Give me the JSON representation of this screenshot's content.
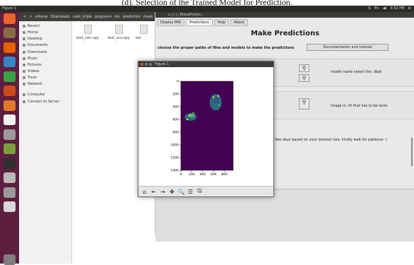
{
  "caption": "(d). Selection of the Trained Model for Prediction.",
  "topbar": {
    "title": "Figure 1",
    "tray": [
      "⇅",
      "En",
      "◀)",
      "3:32 PM",
      "⚙"
    ]
  },
  "launcher": {
    "icons": [
      {
        "name": "ubuntu-dash-icon",
        "color": "#e8642c"
      },
      {
        "name": "files-icon",
        "color": "#8b6a46"
      },
      {
        "name": "firefox-icon",
        "color": "#e66000"
      },
      {
        "name": "writer-icon",
        "color": "#3a84c4"
      },
      {
        "name": "calc-icon",
        "color": "#3ea044"
      },
      {
        "name": "impress-icon",
        "color": "#c94a1a"
      },
      {
        "name": "software-center-icon",
        "color": "#e07a2a"
      },
      {
        "name": "amazon-icon",
        "color": "#f2f2f2"
      },
      {
        "name": "settings-icon",
        "color": "#9b9b9b"
      },
      {
        "name": "spyder-icon",
        "color": "#7ba03c"
      },
      {
        "name": "terminal-icon",
        "color": "#303030"
      },
      {
        "name": "text-editor-icon",
        "color": "#b9b9b9"
      },
      {
        "name": "disk-icon",
        "color": "#9a9a9a"
      },
      {
        "name": "chrome-icon",
        "color": "#d8d8d8"
      },
      {
        "name": "trash-icon",
        "color": "#7e7e7e"
      }
    ]
  },
  "file_manager": {
    "path": [
      "<",
      ">",
      "⌂Home",
      "Downloads",
      "cadc_triple",
      "programs",
      "bin",
      "prediction",
      "mask"
    ],
    "sidebar": [
      {
        "label": "Recent",
        "name": "sidebar-item-recent"
      },
      {
        "label": "Home",
        "name": "sidebar-item-home"
      },
      {
        "label": "Desktop",
        "name": "sidebar-item-desktop"
      },
      {
        "label": "Documents",
        "name": "sidebar-item-documents"
      },
      {
        "label": "Downloads",
        "name": "sidebar-item-downloads"
      },
      {
        "label": "Music",
        "name": "sidebar-item-music"
      },
      {
        "label": "Pictures",
        "name": "sidebar-item-pictures"
      },
      {
        "label": "Videos",
        "name": "sidebar-item-videos"
      },
      {
        "label": "Trash",
        "name": "sidebar-item-trash"
      },
      {
        "label": "Network",
        "name": "sidebar-item-network"
      },
      {
        "label": "Computer",
        "name": "sidebar-item-computer"
      },
      {
        "label": "Connect to Server",
        "name": "sidebar-item-connect-to-server"
      }
    ],
    "files": [
      "test_con.npy",
      "test_ccs.npy",
      "tes"
    ]
  },
  "app": {
    "title": "⌂ ○ ○ RiseaProtoz...",
    "tabs": [
      "Display MRI",
      "Predictions",
      "Help",
      "About"
    ],
    "active_tab": "Predictions",
    "heading": "Make Predictions",
    "subheading": "choose the proper paths of files and models to make the predictions",
    "doc_button": "Documentation and tutorial",
    "model_label": "model name select the .dbpt",
    "image_label": "image in .tif that has to be tests",
    "wait_note": "e a few days based on your dataset size, kindly wait for patience :)"
  },
  "figure": {
    "title": "Figure 1",
    "toolbar": [
      "⌂",
      "←",
      "→",
      "✥",
      "🔍",
      "☰",
      "🖫"
    ]
  },
  "chart_data": {
    "type": "heatmap",
    "title": "",
    "x_ticks": [
      0,
      200,
      400,
      600,
      800
    ],
    "y_ticks": [
      0,
      200,
      400,
      600,
      800,
      1000,
      1200,
      1400
    ],
    "xlim": [
      0,
      960
    ],
    "ylim": [
      1400,
      0
    ],
    "background_color": "#440154",
    "highlight_colors": [
      "#21908c",
      "#5dc963",
      "#fde725",
      "#3b528b"
    ]
  }
}
